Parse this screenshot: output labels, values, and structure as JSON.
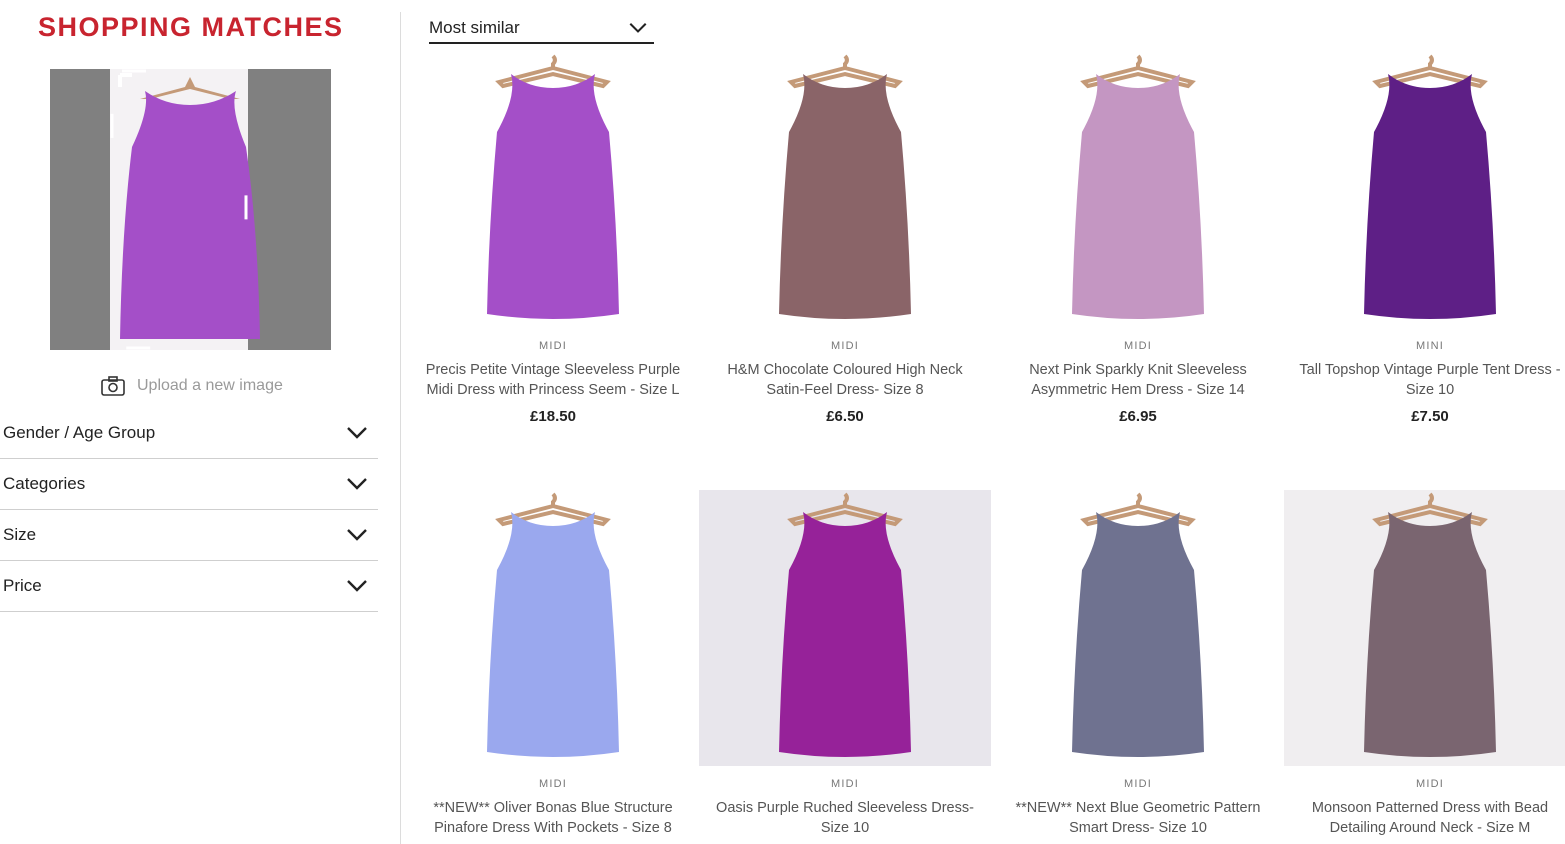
{
  "sidebar": {
    "title": "SHOPPING MATCHES",
    "upload_label": "Upload a new image",
    "filters": [
      {
        "label": "Gender / Age Group"
      },
      {
        "label": "Categories"
      },
      {
        "label": "Size"
      },
      {
        "label": "Price"
      }
    ]
  },
  "sort": {
    "label": "Most similar"
  },
  "products": [
    {
      "category": "MIDI",
      "name": "Precis Petite Vintage Sleeveless Purple Midi Dress with Princess Seem - Size L",
      "price": "£18.50",
      "color": "#a44fc8"
    },
    {
      "category": "MIDI",
      "name": "H&M Chocolate Coloured High Neck Satin-Feel Dress- Size 8",
      "price": "£6.50",
      "color": "#8a6468"
    },
    {
      "category": "MIDI",
      "name": "Next Pink Sparkly Knit Sleeveless Asymmetric Hem Dress - Size 14",
      "price": "£6.95",
      "color": "#c496c2"
    },
    {
      "category": "MINI",
      "name": "Tall Topshop Vintage Purple Tent Dress - Size 10",
      "price": "£7.50",
      "color": "#5e1f86"
    },
    {
      "category": "MIDI",
      "name": "**NEW** Oliver Bonas Blue Structure Pinafore Dress With Pockets - Size 8",
      "price": "",
      "color": "#9aa8ee"
    },
    {
      "category": "MIDI",
      "name": "Oasis Purple Ruched Sleeveless Dress- Size 10",
      "price": "",
      "color": "#962299"
    },
    {
      "category": "MIDI",
      "name": "**NEW** Next Blue Geometric Pattern Smart Dress- Size 10",
      "price": "",
      "color": "#6f7290"
    },
    {
      "category": "MIDI",
      "name": "Monsoon Patterned Dress with Bead Detailing Around Neck - Size M",
      "price": "",
      "color": "#7a6570"
    }
  ]
}
